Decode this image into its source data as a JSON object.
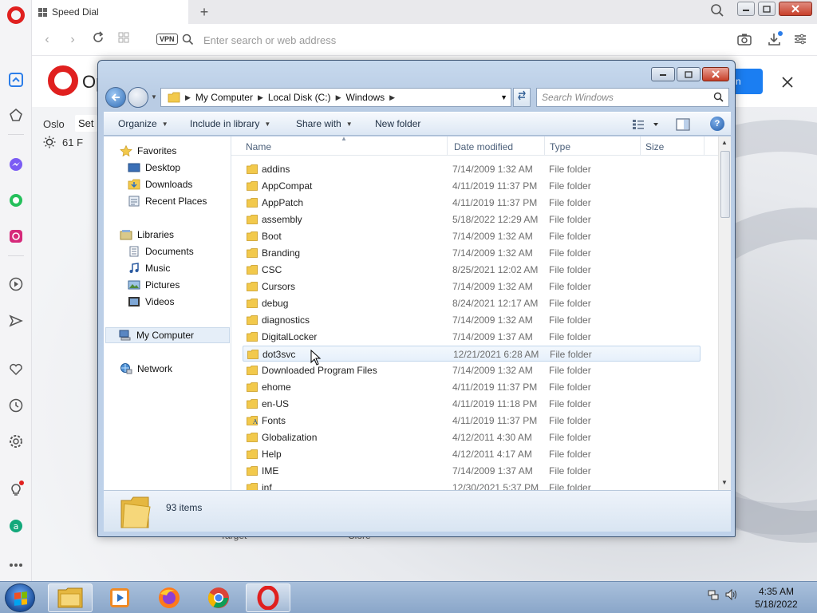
{
  "browser": {
    "tab_title": "Speed Dial",
    "address_placeholder": "Enter search or web address",
    "vpn_label": "VPN",
    "page_brand": "Op",
    "blue_button_label": "n",
    "weather_city": "Oslo",
    "weather_temp": "61 F",
    "set_label": "Set",
    "speed_dial_labels": [
      "Target",
      "Clore"
    ]
  },
  "explorer": {
    "breadcrumbs": [
      "My Computer",
      "Local Disk (C:)",
      "Windows"
    ],
    "search_placeholder": "Search Windows",
    "toolbar": {
      "organize": "Organize",
      "include_in_library": "Include in library",
      "share_with": "Share with",
      "new_folder": "New folder"
    },
    "nav": {
      "favorites": "Favorites",
      "desktop": "Desktop",
      "downloads": "Downloads",
      "recent_places": "Recent Places",
      "libraries": "Libraries",
      "documents": "Documents",
      "music": "Music",
      "pictures": "Pictures",
      "videos": "Videos",
      "my_computer": "My Computer",
      "network": "Network"
    },
    "columns": {
      "name": "Name",
      "date_modified": "Date modified",
      "type": "Type",
      "size": "Size"
    },
    "files": [
      {
        "name": "addins",
        "date": "7/14/2009 1:32 AM",
        "type": "File folder"
      },
      {
        "name": "AppCompat",
        "date": "4/11/2019 11:37 PM",
        "type": "File folder"
      },
      {
        "name": "AppPatch",
        "date": "4/11/2019 11:37 PM",
        "type": "File folder"
      },
      {
        "name": "assembly",
        "date": "5/18/2022 12:29 AM",
        "type": "File folder"
      },
      {
        "name": "Boot",
        "date": "7/14/2009 1:32 AM",
        "type": "File folder"
      },
      {
        "name": "Branding",
        "date": "7/14/2009 1:32 AM",
        "type": "File folder"
      },
      {
        "name": "CSC",
        "date": "8/25/2021 12:02 AM",
        "type": "File folder"
      },
      {
        "name": "Cursors",
        "date": "7/14/2009 1:32 AM",
        "type": "File folder"
      },
      {
        "name": "debug",
        "date": "8/24/2021 12:17 AM",
        "type": "File folder"
      },
      {
        "name": "diagnostics",
        "date": "7/14/2009 1:32 AM",
        "type": "File folder"
      },
      {
        "name": "DigitalLocker",
        "date": "7/14/2009 1:37 AM",
        "type": "File folder"
      },
      {
        "name": "dot3svc",
        "date": "12/21/2021 6:28 AM",
        "type": "File folder"
      },
      {
        "name": "Downloaded Program Files",
        "date": "7/14/2009 1:32 AM",
        "type": "File folder"
      },
      {
        "name": "ehome",
        "date": "4/11/2019 11:37 PM",
        "type": "File folder"
      },
      {
        "name": "en-US",
        "date": "4/11/2019 11:18 PM",
        "type": "File folder"
      },
      {
        "name": "Fonts",
        "date": "4/11/2019 11:37 PM",
        "type": "File folder"
      },
      {
        "name": "Globalization",
        "date": "4/12/2011 4:30 AM",
        "type": "File folder"
      },
      {
        "name": "Help",
        "date": "4/12/2011 4:17 AM",
        "type": "File folder"
      },
      {
        "name": "IME",
        "date": "7/14/2009 1:37 AM",
        "type": "File folder"
      },
      {
        "name": "inf",
        "date": "12/30/2021 5:37 PM",
        "type": "File folder"
      }
    ],
    "status": "93 items"
  },
  "taskbar": {
    "time": "4:35 AM",
    "date": "5/18/2022"
  },
  "colors": {
    "opera_red": "#e0201f",
    "folder_yellow": "#f2c94c",
    "accent_blue": "#1b7ef2"
  }
}
